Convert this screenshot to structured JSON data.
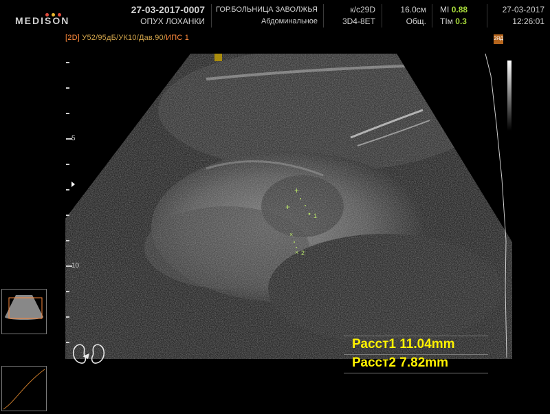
{
  "header": {
    "logo": "MEDISON",
    "logo_dot_colors": [
      "#e04b3c",
      "#e8b62c",
      "#e04b3c"
    ],
    "patient_id": "27-03-2017-0007",
    "study_title": "ОПУХ ЛОХАНКИ",
    "hospital": "ГОР.БОЛЬНИЦА ЗАВОЛЖЬЯ",
    "preset": "Абдоминальное",
    "probe_freq": "к/с29D",
    "probe": "3D4-8ET",
    "depth": "16.0см",
    "app": "Общ.",
    "mi_label": "MI",
    "mi_value": "0.88",
    "tim_label": "TIм",
    "tim_value": "0.3",
    "date": "27-03-2017",
    "time": "12:26:01"
  },
  "mode_line": {
    "tag": "[2D]",
    "params": "У52/95дБ/УК10/Дав.90/",
    "ips": "ИПС 1"
  },
  "depth_labels": [
    "5",
    "10"
  ],
  "measurements": [
    {
      "label": "Расст1",
      "value": "11.04mm"
    },
    {
      "label": "Расст2",
      "value": "7.82mm"
    }
  ],
  "markers": [
    "1",
    "2"
  ],
  "icons": {
    "top_right": "probe-orientation-icon",
    "focus": "focus-marker-icon",
    "body": "kidney-bodymarker-icon",
    "depth_pointer": "depth-pointer-icon",
    "top_right_text": "ЗЯД"
  },
  "colors": {
    "measure_text": "#fff200",
    "caliper": "#b6e06a",
    "value_green": "#a6d93a",
    "mode_orange": "#ff8a3c"
  }
}
